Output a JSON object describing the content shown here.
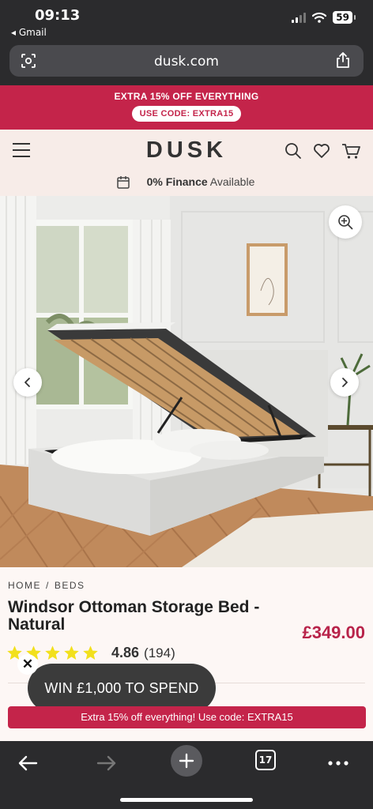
{
  "status_bar": {
    "time": "09:13",
    "back_app": "◂ Gmail",
    "battery": "59"
  },
  "browser": {
    "url": "dusk.com",
    "tab_count": "17"
  },
  "promo": {
    "headline": "EXTRA 15% OFF EVERYTHING",
    "code_label": "USE CODE: EXTRA15"
  },
  "header": {
    "logo": "DUSK",
    "finance_bold": "0% Finance",
    "finance_rest": " Available"
  },
  "breadcrumb": {
    "home": "HOME",
    "separator": "/",
    "category": "BEDS"
  },
  "product": {
    "title": "Windsor Ottoman Storage Bed - Natural",
    "price": "£349.00",
    "rating": "4.86",
    "review_count": "(194)",
    "stars": 5
  },
  "popup": {
    "win_label": "WIN £1,000 TO SPEND",
    "close": "✕"
  },
  "sticky_promo": {
    "text": "Extra 15% off everything! Use code: EXTRA15"
  },
  "colors": {
    "brand_red": "#c4244a",
    "price_red": "#b8234a",
    "star_yellow": "#f2e01c",
    "header_bg": "#f7ece8"
  },
  "icons": [
    "search-icon",
    "heart-icon",
    "basket-icon",
    "menu-icon",
    "calendar-icon",
    "zoom-icon",
    "chevron-left-icon",
    "chevron-right-icon",
    "share-icon",
    "reader-icon",
    "back-icon",
    "forward-icon",
    "plus-icon",
    "more-icon"
  ]
}
